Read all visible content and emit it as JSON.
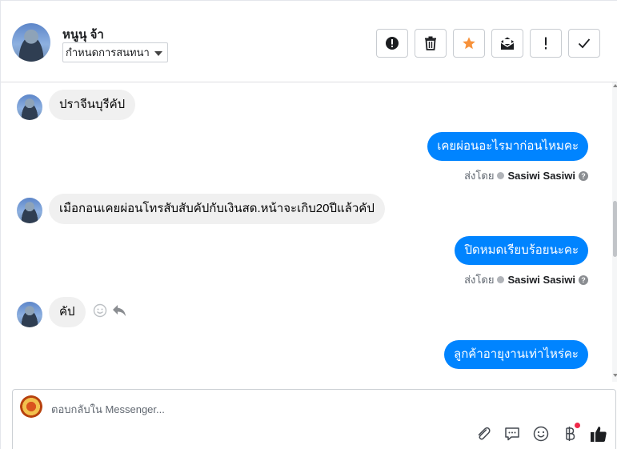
{
  "header": {
    "contact_name": "หนูนุ จ้า",
    "conversation_select": "กำหนดการสนทนา"
  },
  "toolbar": {
    "buttons": [
      {
        "icon": "alert-circle-icon"
      },
      {
        "icon": "trash-icon"
      },
      {
        "icon": "star-icon",
        "color": "#f7923b"
      },
      {
        "icon": "envelope-icon"
      },
      {
        "icon": "exclamation-icon"
      },
      {
        "icon": "check-icon"
      }
    ]
  },
  "messages": [
    {
      "direction": "in",
      "text": "ปราจีนบุรีคัป"
    },
    {
      "direction": "out",
      "text": "เคยผ่อนอะไรมาก่อนไหมคะ",
      "sent_by_label": "ส่งโดย",
      "sender": "Sasiwi Sasiwi"
    },
    {
      "direction": "in",
      "text": "เมือกอนเคยผ่อนโทรสับสับคัปกับเงินสด.หน้าจะเกิบ20ปีแล้วคัป"
    },
    {
      "direction": "out",
      "text": "ปิดหมดเรียบร้อยนะคะ",
      "sent_by_label": "ส่งโดย",
      "sender": "Sasiwi Sasiwi"
    },
    {
      "direction": "in",
      "text": "คัป"
    },
    {
      "direction": "out",
      "text": "ลูกค้าอายุงานเท่าไหร่คะ"
    }
  ],
  "composer": {
    "placeholder": "ตอบกลับใน Messenger..."
  },
  "colors": {
    "outgoing_bubble": "#0084ff",
    "incoming_bubble": "#f0f0f0",
    "notification_dot": "#f02849"
  }
}
